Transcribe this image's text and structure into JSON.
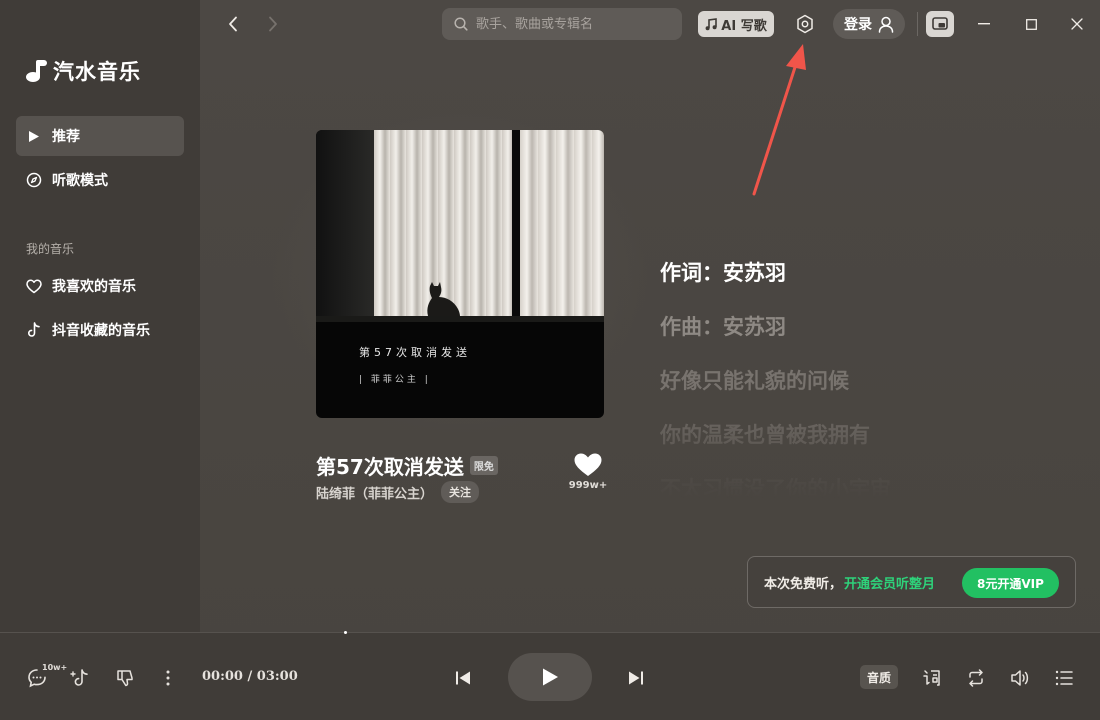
{
  "app": {
    "name": "汽水音乐"
  },
  "sidebar": {
    "items": [
      {
        "label": "推荐",
        "icon": "play-triangle-icon",
        "active": true
      },
      {
        "label": "听歌模式",
        "icon": "compass-icon",
        "active": false
      }
    ],
    "section_title": "我的音乐",
    "my_music": [
      {
        "label": "我喜欢的音乐",
        "icon": "heart-outline-icon"
      },
      {
        "label": "抖音收藏的音乐",
        "icon": "tiktok-icon"
      }
    ]
  },
  "topbar": {
    "search_placeholder": "歌手、歌曲或专辑名",
    "ai_button": "AI 写歌",
    "login_label": "登录"
  },
  "album": {
    "cover_title": "第57次取消发送",
    "cover_artist": "| 菲菲公主 |"
  },
  "song": {
    "title": "第57次取消发送",
    "badge": "限免",
    "artist": "陆绮菲（菲菲公主）",
    "follow_label": "关注",
    "like_count": "999w+"
  },
  "lyrics": [
    "作词：安苏羽",
    "作曲：安苏羽",
    "好像只能礼貌的问候",
    "你的温柔也曾被我拥有",
    "不太习惯没了你的小宇宙"
  ],
  "vip_banner": {
    "text": "本次免费听，",
    "link": "开通会员听整月",
    "button": "8元开通VIP"
  },
  "player": {
    "comment_count": "10w+",
    "time": "00:00 / 03:00",
    "quality_label": "音质",
    "progress": 0
  },
  "colors": {
    "accent_green": "#22c062",
    "annotation_red": "#f0554a"
  }
}
